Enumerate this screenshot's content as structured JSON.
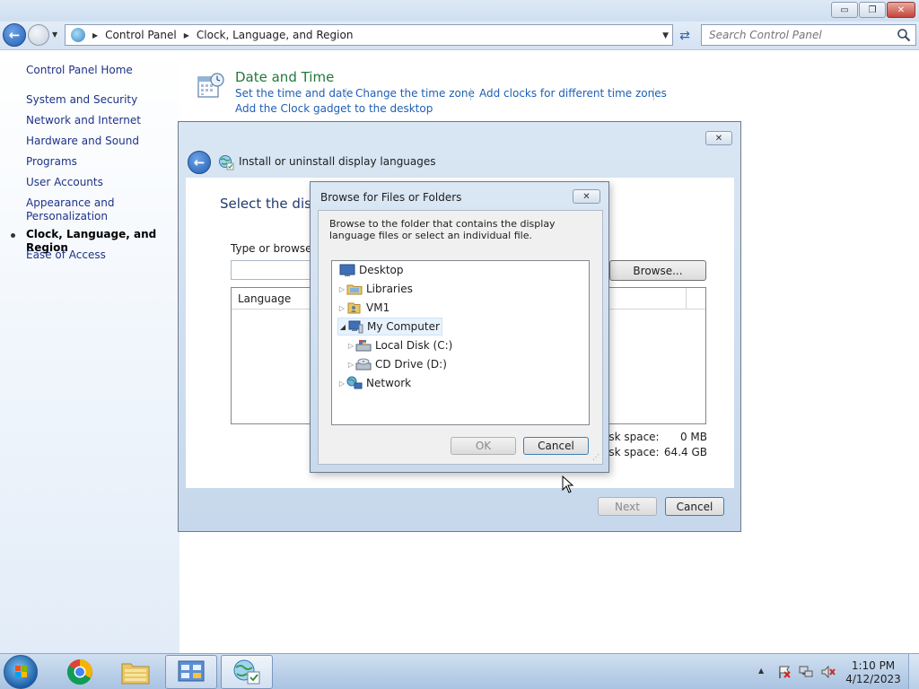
{
  "window": {
    "caption_buttons": {
      "minimize": "▭",
      "maximize": "❐",
      "close": "✕"
    }
  },
  "address": {
    "breadcrumbs": [
      "Control Panel",
      "Clock, Language, and Region"
    ],
    "search_placeholder": "Search Control Panel"
  },
  "sidebar": {
    "home": "Control Panel Home",
    "items": [
      "System and Security",
      "Network and Internet",
      "Hardware and Sound",
      "Programs",
      "User Accounts",
      "Appearance and Personalization",
      "Clock, Language, and Region",
      "Ease of Access"
    ],
    "selected": "Clock, Language, and Region"
  },
  "date_time": {
    "title": "Date and Time",
    "links": [
      "Set the time and date",
      "Change the time zone",
      "Add clocks for different time zones",
      "Add the Clock gadget to the desktop"
    ]
  },
  "wizard": {
    "title": "Install or uninstall display languages",
    "heading": "Select the disp",
    "prompt": "Type or browse t",
    "browse_label": "Browse...",
    "list_column": "Language",
    "required_space_label": "isk space:",
    "required_space_value": "0 MB",
    "available_space_label": "isk space:",
    "available_space_value": "64.4 GB",
    "next_label": "Next",
    "cancel_label": "Cancel"
  },
  "browse_dialog": {
    "title": "Browse for Files or Folders",
    "description": "Browse to the folder that contains the display language files or select an individual file.",
    "tree": [
      {
        "label": "Desktop",
        "icon": "desktop-icon",
        "expander": ""
      },
      {
        "label": "Libraries",
        "icon": "libraries-icon",
        "expander": "collapsed"
      },
      {
        "label": "VM1",
        "icon": "user-folder-icon",
        "expander": "collapsed"
      },
      {
        "label": "My Computer",
        "icon": "computer-icon",
        "expander": "expanded"
      },
      {
        "label": "Local Disk (C:)",
        "icon": "hard-disk-icon",
        "expander": "collapsed"
      },
      {
        "label": "CD Drive (D:)",
        "icon": "cd-drive-icon",
        "expander": "collapsed"
      },
      {
        "label": "Network",
        "icon": "network-icon",
        "expander": "collapsed"
      }
    ],
    "selected_node": "My Computer",
    "ok_label": "OK",
    "cancel_label": "Cancel"
  },
  "taskbar": {
    "time": "1:10 PM",
    "date": "4/12/2023",
    "pinned": [
      "chrome-icon",
      "explorer-icon",
      "control-panel-icon",
      "language-wizard-icon"
    ]
  },
  "colors": {
    "link": "#1e5fb4",
    "sidebar_link": "#1e3287",
    "section_title": "#1f7a3a",
    "window_frame": "#d9e6f3"
  }
}
